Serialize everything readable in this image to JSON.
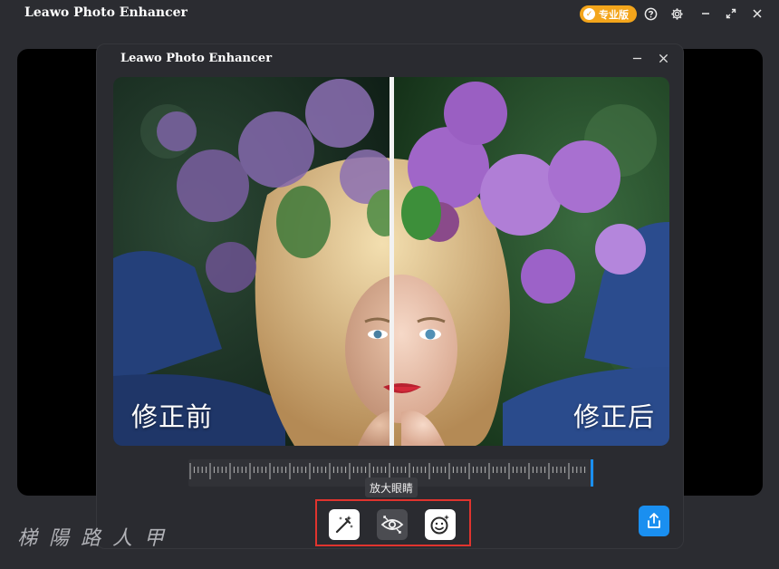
{
  "app": {
    "title": "Leawo Photo Enhancer",
    "pro_badge": "专业版"
  },
  "modal": {
    "title": "Leawo Photo Enhancer"
  },
  "photo": {
    "before_label": "修正前",
    "after_label": "修正后"
  },
  "tooltip": "放大眼睛",
  "tools": [
    {
      "icon": "magic-wand-icon",
      "active": false
    },
    {
      "icon": "enlarge-eyes-icon",
      "active": true
    },
    {
      "icon": "face-sparkle-icon",
      "active": false
    }
  ],
  "watermark": "梯 陽 路 人 甲",
  "colors": {
    "background": "#2b2c31",
    "accent_blue": "#1a8ff0",
    "pro_orange": "#f3a51b",
    "highlight_red": "#e0342e"
  }
}
